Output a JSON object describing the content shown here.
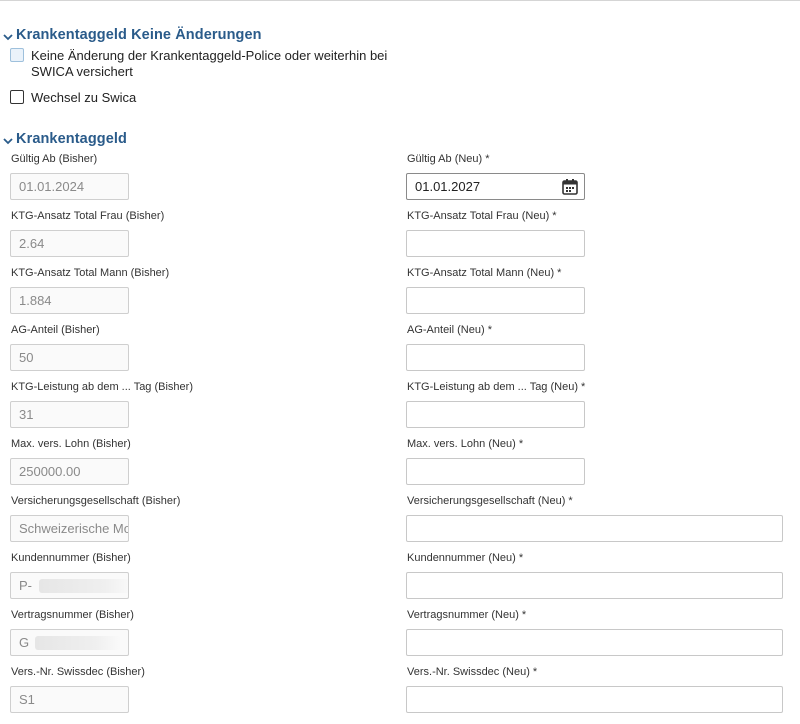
{
  "sections": {
    "keine_aenderungen": {
      "title": "Krankentaggeld Keine Änderungen",
      "options": [
        {
          "label_line1": "Keine Änderung der Krankentaggeld-Police oder weiterhin bei",
          "label_line2": "SWICA versichert",
          "checked": false
        },
        {
          "label": "Wechsel zu Swica",
          "checked": false
        }
      ]
    },
    "krankentaggeld": {
      "title": "Krankentaggeld",
      "rows": [
        {
          "old_label": "Gültig Ab (Bisher)",
          "old_value": "01.01.2024",
          "new_label": "Gültig Ab (Neu) *",
          "new_value": "01.01.2027"
        },
        {
          "old_label": "KTG-Ansatz Total Frau (Bisher)",
          "old_value": "2.64",
          "new_label": "KTG-Ansatz Total Frau (Neu) *",
          "new_value": ""
        },
        {
          "old_label": "KTG-Ansatz Total Mann (Bisher)",
          "old_value": "1.884",
          "new_label": "KTG-Ansatz Total Mann (Neu) *",
          "new_value": ""
        },
        {
          "old_label": "AG-Anteil (Bisher)",
          "old_value": "50",
          "new_label": "AG-Anteil (Neu) *",
          "new_value": ""
        },
        {
          "old_label": "KTG-Leistung ab dem ... Tag (Bisher)",
          "old_value": "31",
          "new_label": "KTG-Leistung ab dem ... Tag (Neu) *",
          "new_value": ""
        },
        {
          "old_label": "Max. vers. Lohn (Bisher)",
          "old_value": "250000.00",
          "new_label": "Max. vers. Lohn (Neu) *",
          "new_value": ""
        },
        {
          "old_label": "Versicherungsgesellschaft (Bisher)",
          "old_value": "Schweizerische Mob",
          "new_label": "Versicherungsgesellschaft (Neu) *",
          "new_value": ""
        },
        {
          "old_label": "Kundennummer (Bisher)",
          "old_value": "P-",
          "new_label": "Kundennummer (Neu) *",
          "new_value": ""
        },
        {
          "old_label": "Vertragsnummer (Bisher)",
          "old_value": "G",
          "new_label": "Vertragsnummer (Neu) *",
          "new_value": ""
        },
        {
          "old_label": "Vers.-Nr. Swissdec (Bisher)",
          "old_value": "S1",
          "new_label": "Vers.-Nr. Swissdec (Neu) *",
          "new_value": ""
        }
      ]
    }
  },
  "icons": {
    "section_toggle": "chevron-down-icon",
    "date_picker": "calendar-icon"
  },
  "colors": {
    "section_title": "#2a5b8a",
    "input_border": "#c8c8c8",
    "disabled_bg": "#fafafa"
  }
}
